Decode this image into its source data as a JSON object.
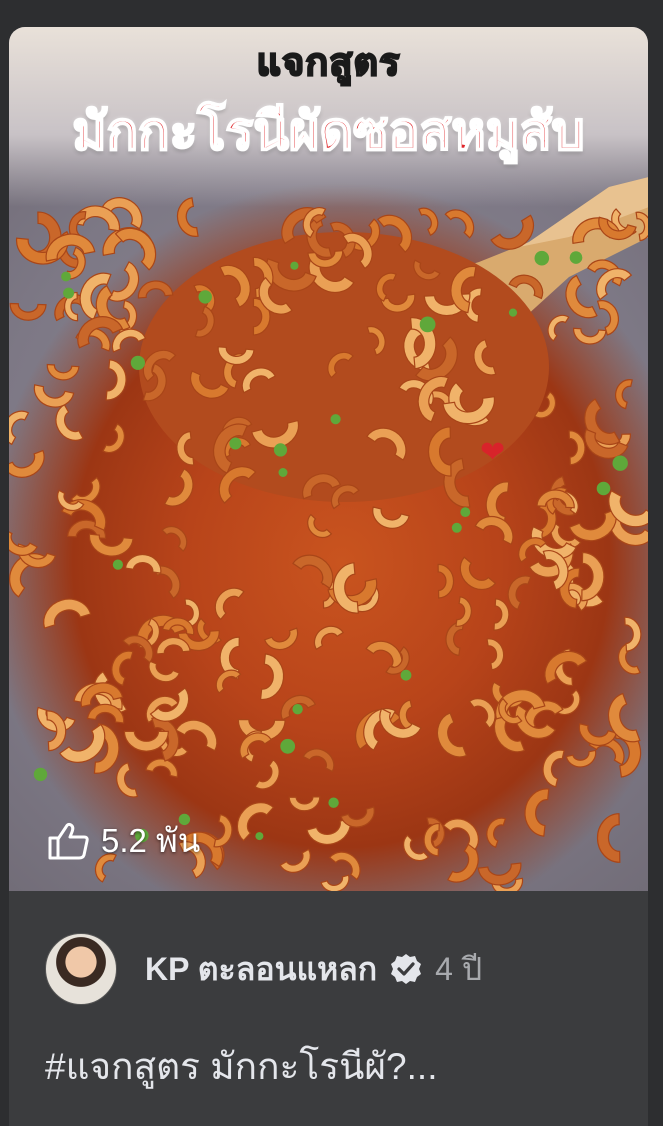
{
  "thumbnail": {
    "overlay_title_small": "แจกสูตร",
    "overlay_title_big": "มักกะโรนีผัดซอสหมูสับ",
    "sticker": "heart-emoji"
  },
  "reactions": {
    "icon": "thumbs-up-icon",
    "count": "5.2 พัน"
  },
  "post": {
    "author": "KP ตะลอนแหลก",
    "verified_icon": "verified-badge-icon",
    "age": "4 ปี",
    "caption": "#แจกสูตร มักกะโรนีผั?..."
  },
  "colors": {
    "background": "#2d2e30",
    "card": "#3b3c3e",
    "title_red": "#e0262a",
    "text_primary": "#e4e6eb",
    "text_secondary": "#a8aaae"
  }
}
